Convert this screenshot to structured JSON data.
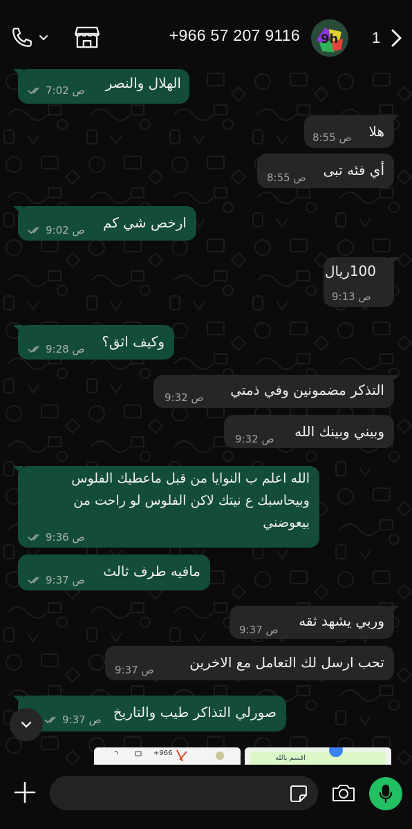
{
  "header": {
    "contact_name": "+966 57 207 9116",
    "unread_count": "1",
    "avatar_text": "9h",
    "icons": [
      "phone-icon",
      "chevron-down-icon",
      "store-icon",
      "chevron-right-icon"
    ]
  },
  "messages": [
    {
      "dir": "out",
      "text": "الهلال والنصر",
      "time": "7:02 ص"
    },
    {
      "dir": "in",
      "text": "هلا",
      "time": "8:55 ص"
    },
    {
      "dir": "in",
      "text": "أي فئه تبى",
      "time": "8:55 ص"
    },
    {
      "dir": "out",
      "text": "ارخص شي كم",
      "time": "9:02 ص"
    },
    {
      "dir": "in",
      "text": "100ريال",
      "time": "9:13 ص"
    },
    {
      "dir": "out",
      "text": "وكيف اثق؟",
      "time": "9:28 ص"
    },
    {
      "dir": "in",
      "text": "التذكر مضمونين وفي ذمتي",
      "time": "9:32 ص"
    },
    {
      "dir": "in",
      "text": "وبيني وبينك الله",
      "time": "9:32 ص"
    },
    {
      "dir": "out",
      "text": "الله اعلم ب النوايا من قبل ماعطيك الفلوس\nوبيحاسبك ع نيتك لاكن الفلوس لو راحت من\nبيعوضني",
      "time": "9:36 ص"
    },
    {
      "dir": "out",
      "text": "مافيه طرف ثالث",
      "time": "9:37 ص"
    },
    {
      "dir": "in",
      "text": "وربي يشهد ثقه",
      "time": "9:37 ص"
    },
    {
      "dir": "in",
      "text": "تحب ارسل لك التعامل مع الاخرين",
      "time": "9:37 ص"
    },
    {
      "dir": "out",
      "text": "صورلي التذاكر طيب والتاريخ",
      "time": "9:37 ص"
    }
  ],
  "thumbnails": [
    {
      "label": "+966"
    },
    {
      "label": "اقسم بالله"
    }
  ],
  "input": {
    "placeholder": ""
  },
  "colors": {
    "background": "#0b0b0b",
    "outgoing_bubble": "#134d37",
    "incoming_bubble": "#262628",
    "read_ticks": "#9aa7a1",
    "mic_button": "#21c063"
  }
}
